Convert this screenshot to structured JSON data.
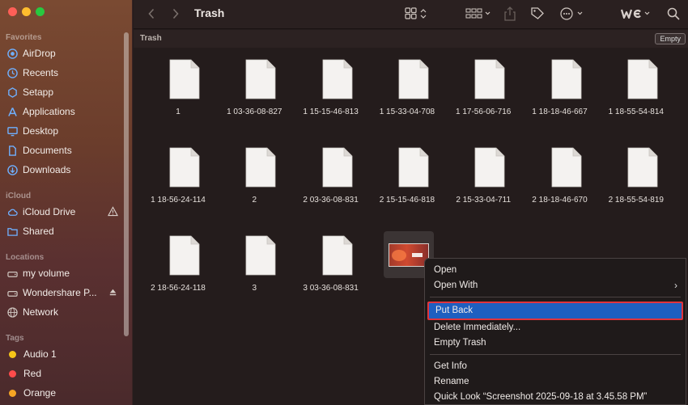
{
  "window": {
    "title": "Trash"
  },
  "sidebar": {
    "sections": {
      "favorites": "Favorites",
      "icloud": "iCloud",
      "locations": "Locations",
      "tags": "Tags"
    },
    "favorites": [
      {
        "label": "AirDrop",
        "icon": "airdrop-icon"
      },
      {
        "label": "Recents",
        "icon": "clock-icon"
      },
      {
        "label": "Setapp",
        "icon": "setapp-icon"
      },
      {
        "label": "Applications",
        "icon": "applications-icon"
      },
      {
        "label": "Desktop",
        "icon": "desktop-icon"
      },
      {
        "label": "Documents",
        "icon": "document-icon"
      },
      {
        "label": "Downloads",
        "icon": "download-icon"
      }
    ],
    "icloud": [
      {
        "label": "iCloud Drive",
        "icon": "cloud-icon"
      },
      {
        "label": "Shared",
        "icon": "shared-folder-icon"
      }
    ],
    "locations": [
      {
        "label": "my volume",
        "icon": "drive-icon"
      },
      {
        "label": "Wondershare P...",
        "icon": "drive-icon"
      },
      {
        "label": "Network",
        "icon": "network-icon"
      }
    ],
    "tags": [
      {
        "label": "Audio 1",
        "color": "#f5c518"
      },
      {
        "label": "Red",
        "color": "#ff4b4b"
      },
      {
        "label": "Orange",
        "color": "#f5a524"
      }
    ]
  },
  "pathbar": {
    "label": "Trash",
    "empty_button": "Empty"
  },
  "files": [
    "1",
    "1 03-36-08-827",
    "1 15-15-46-813",
    "1 15-33-04-708",
    "1 17-56-06-716",
    "1 18-18-46-667",
    "1 18-55-54-814",
    "1 18-56-24-114",
    "2",
    "2 03-36-08-831",
    "2 15-15-46-818",
    "2 15-33-04-711",
    "2 18-18-46-670",
    "2 18-55-54-819",
    "2 18-56-24-118",
    "3",
    "3 03-36-08-831"
  ],
  "context_menu": {
    "open": "Open",
    "open_with": "Open With",
    "put_back": "Put Back",
    "delete_immediately": "Delete Immediately...",
    "empty_trash": "Empty Trash",
    "get_info": "Get Info",
    "rename": "Rename",
    "quick_look": "Quick Look “Screenshot 2025-09-18 at 3.45.58 PM”"
  },
  "colors": {
    "selection": "#1e5fc0",
    "highlight_outline": "#e0343c"
  }
}
